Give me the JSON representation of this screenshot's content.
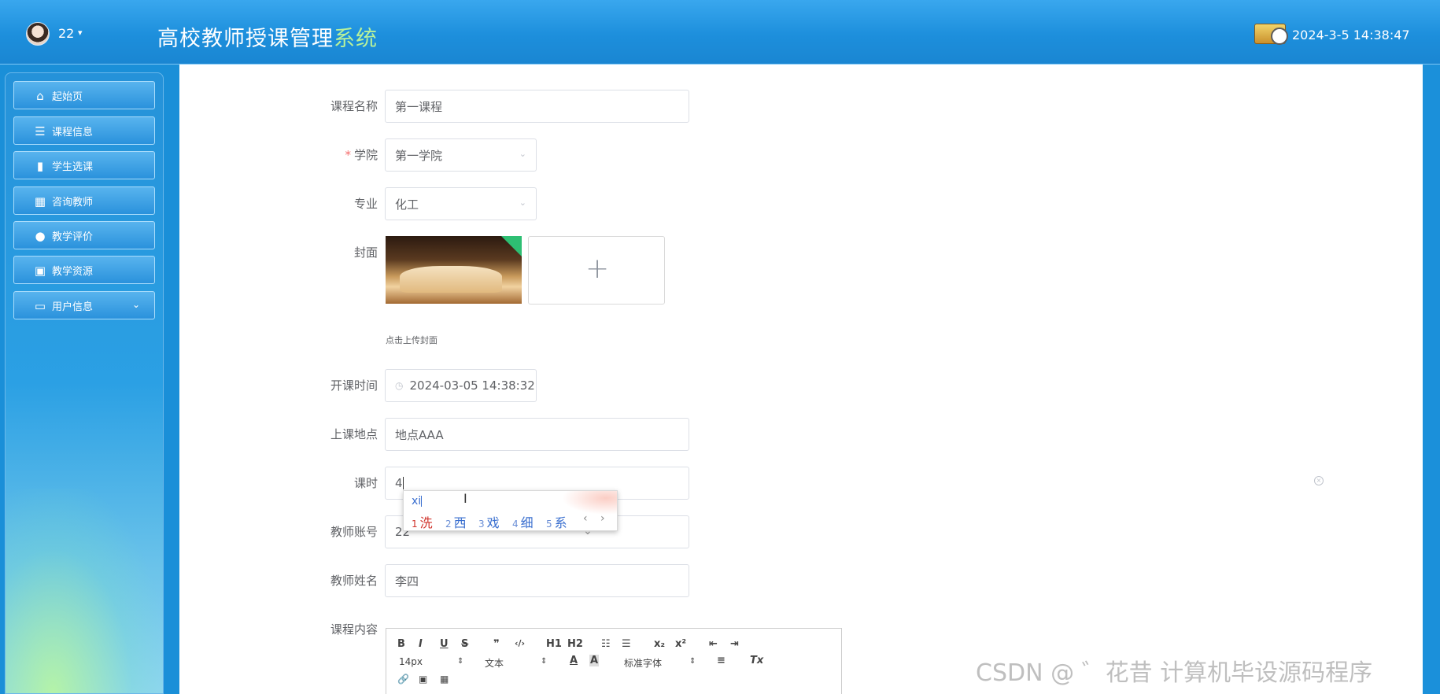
{
  "header": {
    "username": "22",
    "caret": "▾",
    "title_main": "高校教师授课管理",
    "title_suffix": "系统",
    "datetime": "2024-3-5 14:38:47"
  },
  "sidebar": {
    "items": [
      {
        "label": "起始页",
        "icon": "home-icon",
        "glyph": "⌂"
      },
      {
        "label": "课程信息",
        "icon": "sliders-icon",
        "glyph": "☰"
      },
      {
        "label": "学生选课",
        "icon": "bar-chart-icon",
        "glyph": "▮"
      },
      {
        "label": "咨询教师",
        "icon": "grid-icon",
        "glyph": "▦"
      },
      {
        "label": "教学评价",
        "icon": "user-icon",
        "glyph": "●"
      },
      {
        "label": "教学资源",
        "icon": "ticket-icon",
        "glyph": "▣"
      },
      {
        "label": "用户信息",
        "icon": "wallet-icon",
        "glyph": "▭",
        "chevron": "⌄"
      }
    ]
  },
  "form": {
    "course_name": {
      "label": "课程名称",
      "value": "第一课程"
    },
    "college": {
      "label": "学院",
      "required_mark": "*",
      "value": "第一学院",
      "arrow": "⌄"
    },
    "major": {
      "label": "专业",
      "value": "化工",
      "arrow": "⌄"
    },
    "cover": {
      "label": "封面",
      "plus": "+",
      "hint": "点击上传封面"
    },
    "start_time": {
      "label": "开课时间",
      "value": "2024-03-05 14:38:32",
      "icon": "clock-icon",
      "glyph": "◷"
    },
    "location": {
      "label": "上课地点",
      "value": "地点AAA"
    },
    "hours": {
      "label": "课时",
      "value": "4"
    },
    "teacher_account": {
      "label": "教师账号",
      "value": "22"
    },
    "teacher_name": {
      "label": "教师姓名",
      "value": "李四"
    },
    "content": {
      "label": "课程内容"
    }
  },
  "ime": {
    "input": "xi",
    "candidates": [
      {
        "n": "1",
        "char": "洗"
      },
      {
        "n": "2",
        "char": "西"
      },
      {
        "n": "3",
        "char": "戏"
      },
      {
        "n": "4",
        "char": "细"
      },
      {
        "n": "5",
        "char": "系"
      }
    ],
    "nav": "‹ › ⌄"
  },
  "editor": {
    "toolbar_row1": [
      "B",
      "I",
      "U",
      "S",
      "❞",
      "‹/›",
      "H1",
      "H2",
      "☷",
      "☰",
      "x₂",
      "x²",
      "⇤",
      "⇥"
    ],
    "font_size": "14px",
    "block_format": "文本",
    "font_family": "标准字体",
    "toolbar_row1_extra": [
      "A",
      "A",
      "≡",
      "Tx"
    ],
    "toolbar_row2": [
      "🔗",
      "▣",
      "▦"
    ]
  },
  "watermark": "CSDN @ ゛花昔 计算机毕设源码程序"
}
